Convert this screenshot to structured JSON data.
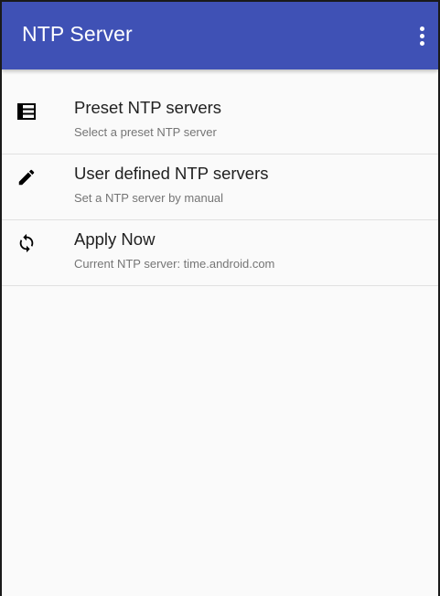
{
  "app_bar": {
    "title": "NTP Server",
    "background_color": "#3f51b5",
    "overflow_icon": "more-vert-icon"
  },
  "preferences": [
    {
      "icon": "list-icon",
      "title": "Preset NTP servers",
      "summary": "Select a preset NTP server"
    },
    {
      "icon": "pencil-icon",
      "title": "User defined NTP servers",
      "summary": "Set a NTP server by manual"
    },
    {
      "icon": "sync-icon",
      "title": "Apply Now",
      "summary": "Current NTP server: time.android.com"
    }
  ]
}
